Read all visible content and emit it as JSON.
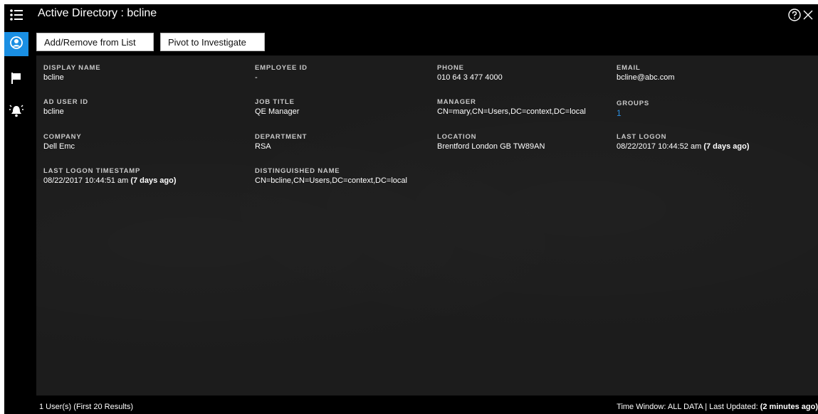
{
  "header": {
    "title": "Active Directory : bcline",
    "add_remove_label": "Add/Remove from List",
    "pivot_label": "Pivot to Investigate"
  },
  "rail": {
    "icons": [
      "list-icon",
      "user-icon",
      "flag-icon",
      "alarm-icon"
    ],
    "accent_color": "#1a8fe3"
  },
  "fields": {
    "display_name": {
      "label": "DISPLAY NAME",
      "value": "bcline"
    },
    "employee_id": {
      "label": "EMPLOYEE ID",
      "value": "-"
    },
    "phone": {
      "label": "PHONE",
      "value": "010 64 3 477 4000"
    },
    "email": {
      "label": "EMAIL",
      "value": "bcline@abc.com"
    },
    "ad_user_id": {
      "label": "AD USER ID",
      "value": "bcline"
    },
    "job_title": {
      "label": "JOB TITLE",
      "value": "QE Manager"
    },
    "manager": {
      "label": "MANAGER",
      "value": "CN=mary,CN=Users,DC=context,DC=local"
    },
    "groups": {
      "label": "GROUPS",
      "value": "1"
    },
    "company": {
      "label": "COMPANY",
      "value": "Dell Emc"
    },
    "department": {
      "label": "DEPARTMENT",
      "value": "RSA"
    },
    "location": {
      "label": "LOCATION",
      "value": "Brentford London GB TW89AN"
    },
    "last_logon": {
      "label": "LAST LOGON",
      "value": "08/22/2017 10:44:52 am",
      "relative": "(7 days ago)"
    },
    "last_logon_timestamp": {
      "label": "LAST LOGON TIMESTAMP",
      "value": "08/22/2017 10:44:51 am",
      "relative": "(7 days ago)"
    },
    "distinguished_name": {
      "label": "DISTINGUISHED NAME",
      "value": "CN=bcline,CN=Users,DC=context,DC=local"
    }
  },
  "footer": {
    "results": "1 User(s) (First 20 Results)",
    "time_window": "Time Window: ALL DATA | Last Updated:",
    "last_updated": "(2 minutes ago)"
  }
}
